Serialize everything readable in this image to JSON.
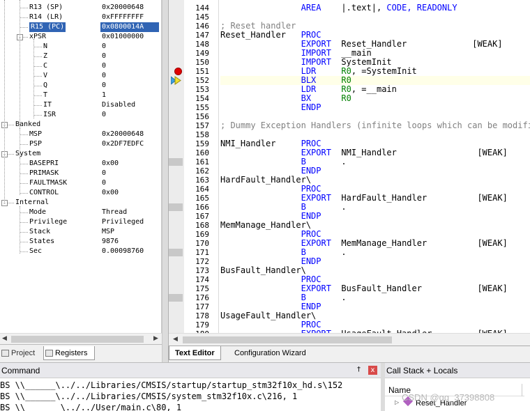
{
  "registers": {
    "rows": [
      {
        "name": "R13 (SP)",
        "value": "0x20000648",
        "selected": false,
        "depth": 2
      },
      {
        "name": "R14 (LR)",
        "value": "0xFFFFFFFF",
        "selected": false,
        "depth": 2
      },
      {
        "name": "R15 (PC)",
        "value": "0x0800014A",
        "selected": true,
        "depth": 2
      },
      {
        "name": "xPSR",
        "value": "0x01000000",
        "selected": false,
        "depth": 2,
        "expander": "-"
      },
      {
        "name": "N",
        "value": "0",
        "selected": false,
        "depth": 3
      },
      {
        "name": "Z",
        "value": "0",
        "selected": false,
        "depth": 3
      },
      {
        "name": "C",
        "value": "0",
        "selected": false,
        "depth": 3
      },
      {
        "name": "V",
        "value": "0",
        "selected": false,
        "depth": 3
      },
      {
        "name": "Q",
        "value": "0",
        "selected": false,
        "depth": 3
      },
      {
        "name": "T",
        "value": "1",
        "selected": false,
        "depth": 3
      },
      {
        "name": "IT",
        "value": "Disabled",
        "selected": false,
        "depth": 3
      },
      {
        "name": "ISR",
        "value": "0",
        "selected": false,
        "depth": 3
      },
      {
        "name": "Banked",
        "value": "",
        "selected": false,
        "depth": 1,
        "expander": "-"
      },
      {
        "name": "MSP",
        "value": "0x20000648",
        "selected": false,
        "depth": 2
      },
      {
        "name": "PSP",
        "value": "0x2DF7EDFC",
        "selected": false,
        "depth": 2
      },
      {
        "name": "System",
        "value": "",
        "selected": false,
        "depth": 1,
        "expander": "-"
      },
      {
        "name": "BASEPRI",
        "value": "0x00",
        "selected": false,
        "depth": 2
      },
      {
        "name": "PRIMASK",
        "value": "0",
        "selected": false,
        "depth": 2
      },
      {
        "name": "FAULTMASK",
        "value": "0",
        "selected": false,
        "depth": 2
      },
      {
        "name": "CONTROL",
        "value": "0x00",
        "selected": false,
        "depth": 2
      },
      {
        "name": "Internal",
        "value": "",
        "selected": false,
        "depth": 1,
        "expander": "-"
      },
      {
        "name": "Mode",
        "value": "Thread",
        "selected": false,
        "depth": 2
      },
      {
        "name": "Privilege",
        "value": "Privileged",
        "selected": false,
        "depth": 2
      },
      {
        "name": "Stack",
        "value": "MSP",
        "selected": false,
        "depth": 2
      },
      {
        "name": "States",
        "value": "9876",
        "selected": false,
        "depth": 2
      },
      {
        "name": "Sec",
        "value": "0.00098760",
        "selected": false,
        "depth": 2
      }
    ]
  },
  "left_tabs": {
    "project": "Project",
    "registers": "Registers"
  },
  "editor": {
    "current_line": 152,
    "breakpoint_line": 151,
    "marked_lines": [
      161,
      166,
      171,
      176
    ],
    "lines": [
      {
        "no": "144",
        "segs": [
          [
            "kw",
            "                AREA    "
          ],
          [
            "tx",
            "|.text|, "
          ],
          [
            "kw",
            "CODE, READONLY"
          ]
        ]
      },
      {
        "no": "145",
        "segs": []
      },
      {
        "no": "146",
        "segs": [
          [
            "cm",
            "; Reset handler"
          ]
        ]
      },
      {
        "no": "147",
        "segs": [
          [
            "tx",
            "Reset_Handler   "
          ],
          [
            "kw",
            "PROC"
          ]
        ]
      },
      {
        "no": "148",
        "segs": [
          [
            "kw",
            "                EXPORT  "
          ],
          [
            "tx",
            "Reset_Handler             [WEAK]"
          ]
        ]
      },
      {
        "no": "149",
        "segs": [
          [
            "kw",
            "                IMPORT  "
          ],
          [
            "tx",
            "__main"
          ]
        ]
      },
      {
        "no": "150",
        "segs": [
          [
            "kw",
            "                IMPORT  "
          ],
          [
            "tx",
            "SystemInit"
          ]
        ]
      },
      {
        "no": "151",
        "segs": [
          [
            "kw",
            "                LDR     "
          ],
          [
            "gr",
            "R0"
          ],
          [
            "tx",
            ", =SystemInit"
          ]
        ]
      },
      {
        "no": "152",
        "segs": [
          [
            "kw",
            "                BLX     "
          ],
          [
            "gr",
            "R0"
          ]
        ]
      },
      {
        "no": "153",
        "segs": [
          [
            "kw",
            "                LDR     "
          ],
          [
            "gr",
            "R0"
          ],
          [
            "tx",
            ", =__main"
          ]
        ]
      },
      {
        "no": "154",
        "segs": [
          [
            "kw",
            "                BX      "
          ],
          [
            "gr",
            "R0"
          ]
        ]
      },
      {
        "no": "155",
        "segs": [
          [
            "kw",
            "                ENDP"
          ]
        ]
      },
      {
        "no": "156",
        "segs": []
      },
      {
        "no": "157",
        "segs": [
          [
            "cm",
            "; Dummy Exception Handlers (infinite loops which can be modified)"
          ]
        ]
      },
      {
        "no": "158",
        "segs": []
      },
      {
        "no": "159",
        "segs": [
          [
            "tx",
            "NMI_Handler     "
          ],
          [
            "kw",
            "PROC"
          ]
        ]
      },
      {
        "no": "160",
        "segs": [
          [
            "kw",
            "                EXPORT  "
          ],
          [
            "tx",
            "NMI_Handler                [WEAK]"
          ]
        ]
      },
      {
        "no": "161",
        "segs": [
          [
            "kw",
            "                B       "
          ],
          [
            "tx",
            "."
          ]
        ]
      },
      {
        "no": "162",
        "segs": [
          [
            "kw",
            "                ENDP"
          ]
        ]
      },
      {
        "no": "163",
        "segs": [
          [
            "tx",
            "HardFault_Handler\\"
          ]
        ]
      },
      {
        "no": "164",
        "segs": [
          [
            "kw",
            "                PROC"
          ]
        ]
      },
      {
        "no": "165",
        "segs": [
          [
            "kw",
            "                EXPORT  "
          ],
          [
            "tx",
            "HardFault_Handler          [WEAK]"
          ]
        ]
      },
      {
        "no": "166",
        "segs": [
          [
            "kw",
            "                B       "
          ],
          [
            "tx",
            "."
          ]
        ]
      },
      {
        "no": "167",
        "segs": [
          [
            "kw",
            "                ENDP"
          ]
        ]
      },
      {
        "no": "168",
        "segs": [
          [
            "tx",
            "MemManage_Handler\\"
          ]
        ]
      },
      {
        "no": "169",
        "segs": [
          [
            "kw",
            "                PROC"
          ]
        ]
      },
      {
        "no": "170",
        "segs": [
          [
            "kw",
            "                EXPORT  "
          ],
          [
            "tx",
            "MemManage_Handler          [WEAK]"
          ]
        ]
      },
      {
        "no": "171",
        "segs": [
          [
            "kw",
            "                B       "
          ],
          [
            "tx",
            "."
          ]
        ]
      },
      {
        "no": "172",
        "segs": [
          [
            "kw",
            "                ENDP"
          ]
        ]
      },
      {
        "no": "173",
        "segs": [
          [
            "tx",
            "BusFault_Handler\\"
          ]
        ]
      },
      {
        "no": "174",
        "segs": [
          [
            "kw",
            "                PROC"
          ]
        ]
      },
      {
        "no": "175",
        "segs": [
          [
            "kw",
            "                EXPORT  "
          ],
          [
            "tx",
            "BusFault_Handler           [WEAK]"
          ]
        ]
      },
      {
        "no": "176",
        "segs": [
          [
            "kw",
            "                B       "
          ],
          [
            "tx",
            "."
          ]
        ]
      },
      {
        "no": "177",
        "segs": [
          [
            "kw",
            "                ENDP"
          ]
        ]
      },
      {
        "no": "178",
        "segs": [
          [
            "tx",
            "UsageFault_Handler\\"
          ]
        ]
      },
      {
        "no": "179",
        "segs": [
          [
            "kw",
            "                PROC"
          ]
        ]
      },
      {
        "no": "180",
        "segs": [
          [
            "kw",
            "                EXPORT  "
          ],
          [
            "tx",
            "UsageFault_Handler         [WEAK]"
          ]
        ]
      }
    ]
  },
  "editor_tabs": {
    "text_editor": "Text Editor",
    "config_wizard": "Configuration Wizard"
  },
  "command": {
    "title": "Command",
    "pin": "†",
    "close": "x",
    "lines": [
      "BS \\\\______\\../../Libraries/CMSIS/startup/startup_stm32f10x_hd.s\\152",
      "BS \\\\______\\../../Libraries/CMSIS/system_stm32f10x.c\\216, 1",
      "BS \\\\       \\../../User/main.c\\80, 1"
    ]
  },
  "callstack": {
    "title": "Call Stack + Locals",
    "column_name": "Name",
    "row": "Reset_Handler",
    "watermark": "CSDN @qq_37398808"
  },
  "colors": {
    "selection": "#3064b4",
    "keyword": "#0000ff",
    "comment": "#808080",
    "register": "#008000"
  }
}
